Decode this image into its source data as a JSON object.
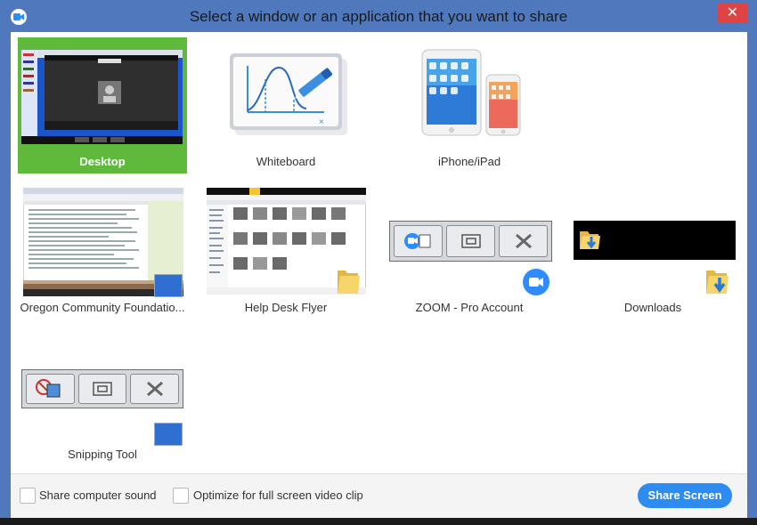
{
  "window": {
    "title": "Select a window or an application that you want to share",
    "close_label": "✕"
  },
  "tiles": [
    {
      "label": "Desktop",
      "selected": true
    },
    {
      "label": "Whiteboard"
    },
    {
      "label": "iPhone/iPad"
    },
    {
      "label": "Oregon Community Foundatio..."
    },
    {
      "label": "Help Desk Flyer"
    },
    {
      "label": "ZOOM - Pro Account"
    },
    {
      "label": "Downloads"
    },
    {
      "label": "Snipping Tool"
    }
  ],
  "footer": {
    "share_sound_label": "Share computer sound",
    "optimize_video_label": "Optimize for full screen video clip",
    "share_button_label": "Share Screen"
  },
  "colors": {
    "title_bar": "#4f78bd",
    "selected_tile": "#5fba3c",
    "share_button": "#2e8cf0",
    "close_button": "#e04343"
  },
  "icons": {
    "app": "zoom-icon",
    "close": "close-icon"
  }
}
